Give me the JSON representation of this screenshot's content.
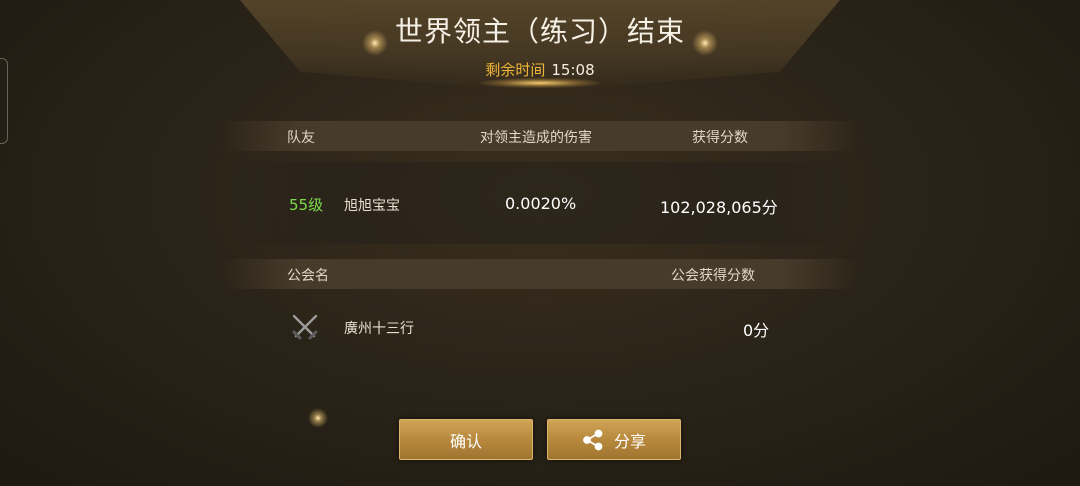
{
  "header": {
    "title": "世界领主（练习）结束",
    "timer_label": "剩余时间",
    "timer_value": "15:08"
  },
  "damage_table": {
    "columns": [
      "队友",
      "对领主造成的伤害",
      "获得分数"
    ],
    "rows": [
      {
        "level": "55级",
        "name": "旭旭宝宝",
        "damage": "0.0020%",
        "score": "102,028,065分"
      }
    ]
  },
  "guild_table": {
    "columns": [
      "公会名",
      "公会获得分数"
    ],
    "rows": [
      {
        "icon": "crossed-swords-icon",
        "name": "廣州十三行",
        "score": "0分"
      }
    ]
  },
  "buttons": {
    "confirm": "确认",
    "share": "分享"
  },
  "colors": {
    "accent_gold": "#f0b53a",
    "level_green": "#7bdc4a",
    "button_gold": "#b8893d"
  }
}
